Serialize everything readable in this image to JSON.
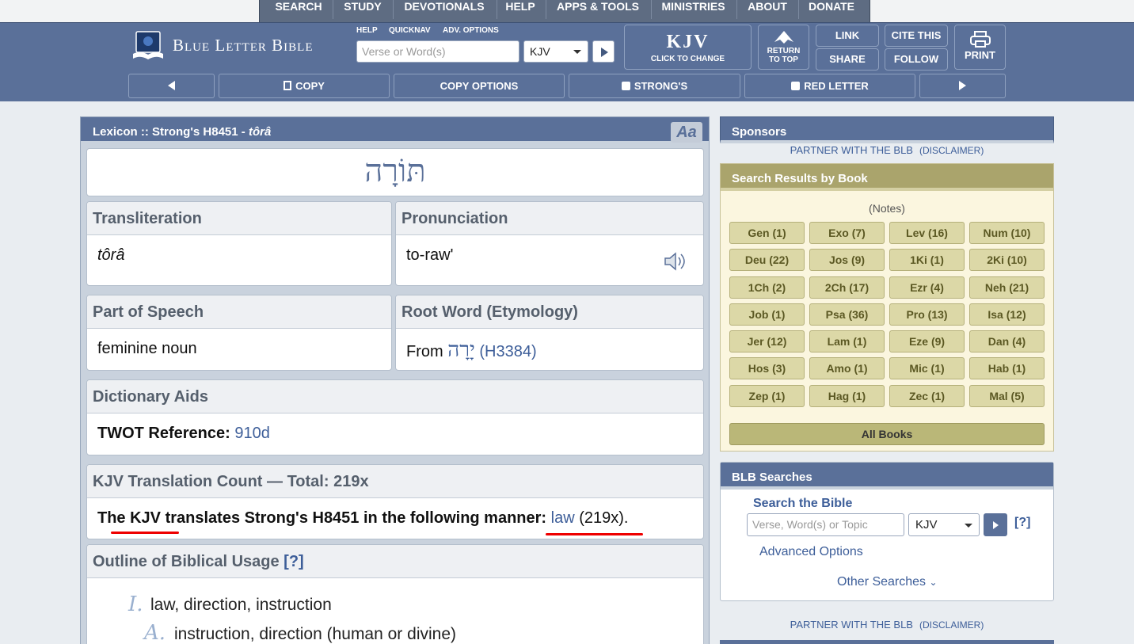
{
  "topnav": [
    "SEARCH",
    "STUDY",
    "DEVOTIONALS",
    "HELP",
    "APPS & TOOLS",
    "MINISTRIES",
    "ABOUT",
    "DONATE"
  ],
  "header": {
    "logo_text": "Blue Letter Bible",
    "help": "HELP",
    "quicknav": "QUICKNAV",
    "adv_options": "ADV. OPTIONS",
    "search_placeholder": "Verse or Word(s)",
    "version": "KJV",
    "kjv_big": "KJV",
    "kjv_small": "CLICK TO CHANGE",
    "return_l1": "RETURN",
    "return_l2": "TO TOP",
    "link": "LINK",
    "share": "SHARE",
    "cite": "CITE THIS",
    "follow": "FOLLOW",
    "print": "PRINT"
  },
  "toolbar": {
    "copy": "COPY",
    "copy_options": "COPY OPTIONS",
    "strongs": "STRONG'S",
    "red_letter": "RED LETTER"
  },
  "lexicon": {
    "title_prefix": "Lexicon :: Strong's H8451 - ",
    "title_word": "tôrâ",
    "aa": "Aa",
    "hebrew": "תּוֹרָה",
    "translit_head": "Transliteration",
    "translit": "tôrâ",
    "pron_head": "Pronunciation",
    "pron": "to-raw'",
    "pos_head": "Part of Speech",
    "pos": "feminine noun",
    "root_head": "Root Word (Etymology)",
    "root_from": "From",
    "root_hebrew": "יָרָה",
    "root_link": "(H3384)",
    "dict_head": "Dictionary Aids",
    "twot_label": "TWOT Reference:",
    "twot_value": "910d",
    "count_head": "KJV Translation Count — Total: 219x",
    "count_text": "The KJV translates Strong's H8451 in the following manner:",
    "count_word": "law",
    "count_num": "(219x).",
    "outline_head": "Outline of Biblical Usage",
    "outline_help": "[?]",
    "outline_l1_num": "I.",
    "outline_l1": "law, direction, instruction",
    "outline_l2_num": "A.",
    "outline_l2": "instruction, direction (human or divine)"
  },
  "sidebar": {
    "sponsors": "Sponsors",
    "partner": "PARTNER WITH THE BLB",
    "disclaimer": "(DISCLAIMER)",
    "results_head": "Search Results by Book",
    "notes": "(Notes)",
    "books": [
      "Gen (1)",
      "Exo (7)",
      "Lev (16)",
      "Num (10)",
      "Deu (22)",
      "Jos (9)",
      "1Ki (1)",
      "2Ki (10)",
      "1Ch (2)",
      "2Ch (17)",
      "Ezr (4)",
      "Neh (21)",
      "Job (1)",
      "Psa (36)",
      "Pro (13)",
      "Isa (12)",
      "Jer (12)",
      "Lam (1)",
      "Eze (9)",
      "Dan (4)",
      "Hos (3)",
      "Amo (1)",
      "Mic (1)",
      "Hab (1)",
      "Zep (1)",
      "Hag (1)",
      "Zec (1)",
      "Mal (5)"
    ],
    "all_books": "All Books",
    "blb_head": "BLB Searches",
    "search_bible": "Search the Bible",
    "search_placeholder": "Verse, Word(s) or Topic",
    "version": "KJV",
    "help": "[?]",
    "advanced": "Advanced Options",
    "other": "Other Searches"
  }
}
